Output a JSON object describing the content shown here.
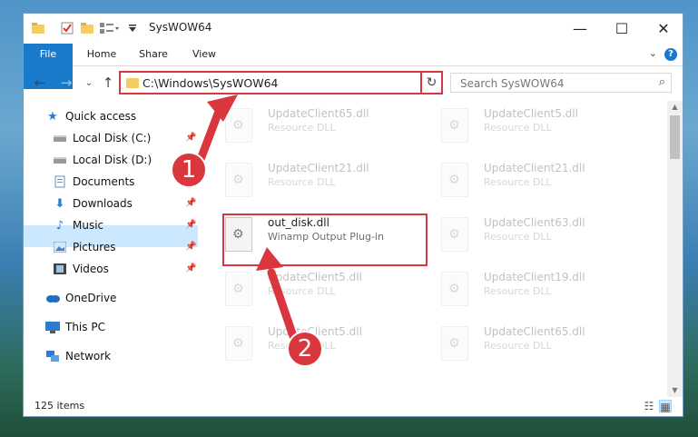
{
  "window": {
    "title": "SysWOW64",
    "controls": {
      "minimize": "—",
      "maximize": "☐",
      "close": "✕"
    }
  },
  "ribbon": {
    "tabs": [
      "File",
      "Home",
      "Share",
      "View"
    ],
    "help": "?"
  },
  "address": {
    "path": "C:\\Windows\\SysWOW64",
    "search_placeholder": "Search SysWOW64"
  },
  "sidebar": {
    "items": [
      {
        "label": "Quick access",
        "icon": "star-icon",
        "pinned": false
      },
      {
        "label": "Local Disk (C:)",
        "icon": "drive-icon",
        "pinned": true
      },
      {
        "label": "Local Disk (D:)",
        "icon": "drive-icon",
        "pinned": false
      },
      {
        "label": "Documents",
        "icon": "documents-icon",
        "pinned": true
      },
      {
        "label": "Downloads",
        "icon": "download-icon",
        "pinned": true
      },
      {
        "label": "Music",
        "icon": "music-icon",
        "pinned": true
      },
      {
        "label": "Pictures",
        "icon": "pictures-icon",
        "pinned": true
      },
      {
        "label": "Videos",
        "icon": "videos-icon",
        "pinned": true
      },
      {
        "label": "OneDrive",
        "icon": "cloud-icon",
        "pinned": false
      },
      {
        "label": "This PC",
        "icon": "computer-icon",
        "pinned": false,
        "selected": true
      },
      {
        "label": "Network",
        "icon": "network-icon",
        "pinned": false
      }
    ]
  },
  "files": {
    "left": [
      {
        "name": "UpdateClient65.dll",
        "type": "Resource DLL",
        "faded": true
      },
      {
        "name": "UpdateClient21.dll",
        "type": "Resource DLL",
        "faded": true
      },
      {
        "name": "out_disk.dll",
        "type": "Winamp Output Plug-in",
        "faded": false
      },
      {
        "name": "UpdateClient5.dll",
        "type": "Resource DLL",
        "faded": true
      },
      {
        "name": "UpdateClient5.dll",
        "type": "Resource DLL",
        "faded": true
      }
    ],
    "right": [
      {
        "name": "UpdateClient5.dll",
        "type": "Resource DLL",
        "faded": true
      },
      {
        "name": "UpdateClient21.dll",
        "type": "Resource DLL",
        "faded": true
      },
      {
        "name": "UpdateClient63.dll",
        "type": "Resource DLL",
        "faded": true
      },
      {
        "name": "UpdateClient19.dll",
        "type": "Resource DLL",
        "faded": true
      },
      {
        "name": "UpdateClient65.dll",
        "type": "Resource DLL",
        "faded": true
      }
    ]
  },
  "status": {
    "item_count": "125 items"
  },
  "annotations": [
    {
      "label": "1"
    },
    {
      "label": "2"
    }
  ],
  "colors": {
    "accent": "#1979ca",
    "highlight": "#d9363e",
    "selection": "#cce8ff"
  }
}
